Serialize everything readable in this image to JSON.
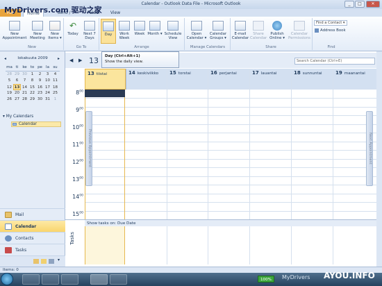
{
  "app": {
    "title": "Calendar - Outlook Data File - Microsoft Outlook",
    "watermark": "MyDrivers.com 驱动之家"
  },
  "tabs": [
    {
      "label": "File",
      "active": false
    },
    {
      "label": "Home",
      "active": true
    },
    {
      "label": "Send / Receive",
      "active": false
    },
    {
      "label": "Folder",
      "active": false
    },
    {
      "label": "View",
      "active": false
    }
  ],
  "ribbon": {
    "groups": [
      {
        "name": "New",
        "buttons": [
          "New Appointment",
          "New Meeting",
          "New Items ▾"
        ]
      },
      {
        "name": "Go To",
        "buttons": [
          "Today",
          "Next 7 Days"
        ]
      },
      {
        "name": "Arrange",
        "buttons": [
          "Day",
          "Work Week",
          "Week",
          "Month ▾",
          "Schedule View"
        ]
      },
      {
        "name": "Manage Calendars",
        "buttons": [
          "Open Calendar ▾",
          "Calendar Groups ▾"
        ]
      },
      {
        "name": "Share",
        "buttons": [
          "E-mail Calendar",
          "Share Calendar",
          "Publish Online ▾",
          "Calendar Permissions"
        ]
      },
      {
        "name": "Find",
        "buttons": [
          "Find a Contact ▾",
          "Address Book"
        ]
      }
    ]
  },
  "tooltip": {
    "title": "Day (Ctrl+Alt+1)",
    "body": "Show the daily view."
  },
  "mini_calendar": {
    "month": "lokakuuta 2009",
    "weekdays": [
      "ma",
      "ti",
      "ke",
      "to",
      "pe",
      "la",
      "su"
    ],
    "weeks": [
      [
        "28",
        "29",
        "30",
        "1",
        "2",
        "3",
        "4"
      ],
      [
        "5",
        "6",
        "7",
        "8",
        "9",
        "10",
        "11"
      ],
      [
        "12",
        "13",
        "14",
        "15",
        "16",
        "17",
        "18"
      ],
      [
        "19",
        "20",
        "21",
        "22",
        "23",
        "24",
        "25"
      ],
      [
        "26",
        "27",
        "28",
        "29",
        "30",
        "31",
        "1"
      ]
    ],
    "today": "13"
  },
  "my_calendars": {
    "header": "My Calendars",
    "items": [
      "Calendar"
    ]
  },
  "nav_buttons": [
    "Mail",
    "Calendar",
    "Contacts",
    "Tasks"
  ],
  "calendar": {
    "big_date": "13",
    "search_placeholder": "Search Calendar (Ctrl+E)",
    "days": [
      {
        "num": "13",
        "name": "tiistai"
      },
      {
        "num": "14",
        "name": "keskiviikko"
      },
      {
        "num": "15",
        "name": "torstai"
      },
      {
        "num": "16",
        "name": "perjantai"
      },
      {
        "num": "17",
        "name": "lauantai"
      },
      {
        "num": "18",
        "name": "sunnuntai"
      },
      {
        "num": "19",
        "name": "maanantai"
      }
    ],
    "hours": [
      "8",
      "9",
      "10",
      "11",
      "12",
      "13",
      "14",
      "15"
    ],
    "minutes": "00",
    "prev_tab": "Previous Appointment",
    "next_tab": "Next Appointment",
    "tasks_header": "Show tasks on: Due Date",
    "tasks_label": "Tasks"
  },
  "status": {
    "items": "Items: 0",
    "zoom": "100%"
  },
  "taskbar_watermark": "MyDrivers",
  "corner_watermark": "AYOU.INFO",
  "colors": {
    "accent": "#e8a33c",
    "today": "#fbe59d",
    "ribbon": "#e3ecf8"
  }
}
